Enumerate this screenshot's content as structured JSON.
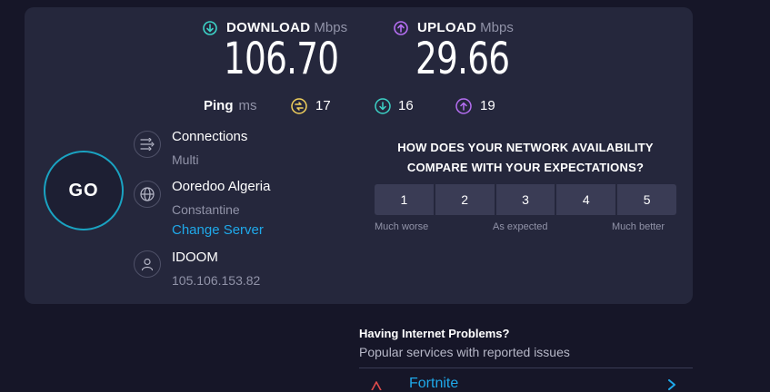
{
  "download": {
    "label": "DOWNLOAD",
    "unit": "Mbps",
    "value": "106.70",
    "icon": "arrow-down-circle-icon",
    "color": "#3cd3c7"
  },
  "upload": {
    "label": "UPLOAD",
    "unit": "Mbps",
    "value": "29.66",
    "icon": "arrow-up-circle-icon",
    "color": "#b56ef2"
  },
  "ping": {
    "label": "Ping",
    "unit": "ms",
    "idle": {
      "value": "17",
      "icon": "ping-idle-icon",
      "color": "#f2d15c"
    },
    "download": {
      "value": "16",
      "icon": "ping-download-icon",
      "color": "#3cd3c7"
    },
    "upload": {
      "value": "19",
      "icon": "ping-upload-icon",
      "color": "#b56ef2"
    }
  },
  "go_button": {
    "label": "GO"
  },
  "connections": {
    "title": "Connections",
    "value": "Multi",
    "icon": "connections-icon"
  },
  "server": {
    "title": "Ooredoo Algeria",
    "location": "Constantine",
    "change_link": "Change Server",
    "icon": "globe-icon"
  },
  "isp": {
    "title": "IDOOM",
    "ip": "105.106.153.82",
    "icon": "user-icon"
  },
  "survey": {
    "question_line1": "HOW DOES YOUR NETWORK AVAILABILITY",
    "question_line2": "COMPARE WITH YOUR EXPECTATIONS?",
    "options": [
      "1",
      "2",
      "3",
      "4",
      "5"
    ],
    "low_label": "Much worse",
    "mid_label": "As expected",
    "high_label": "Much better"
  },
  "problems": {
    "title": "Having Internet Problems?",
    "subtitle": "Popular services with reported issues",
    "first_service": "Fortnite"
  },
  "colors": {
    "background": "#161628",
    "panel": "#25273c",
    "accent_link": "#1fa9ea",
    "go_ring": "#1aa3c2"
  }
}
